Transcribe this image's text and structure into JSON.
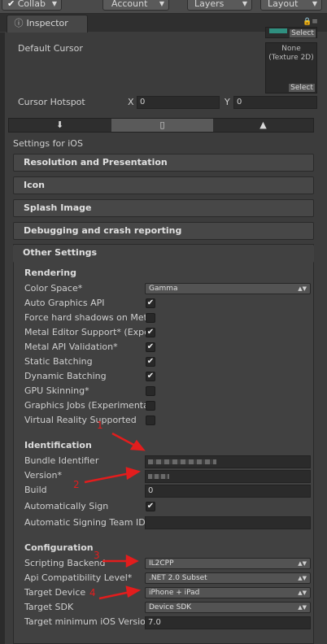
{
  "toolbar": {
    "collab": "Collab",
    "account": "Account",
    "layers": "Layers",
    "layout": "Layout"
  },
  "tab": {
    "label": "Inspector"
  },
  "cursor": {
    "default_cursor_label": "Default Cursor",
    "texture_none": "None",
    "texture_type": "(Texture 2D)",
    "select_label": "Select",
    "hotspot_label": "Cursor Hotspot",
    "x_label": "X",
    "x_value": "0",
    "y_label": "Y",
    "y_value": "0"
  },
  "platforms": {
    "icons": [
      "download-icon",
      "iphone-icon",
      "android-icon"
    ],
    "selected": 1
  },
  "settings_for": "Settings for iOS",
  "sections": {
    "resolution": "Resolution and Presentation",
    "icon": "Icon",
    "splash": "Splash Image",
    "debugging": "Debugging and crash reporting",
    "other": "Other Settings"
  },
  "rendering": {
    "header": "Rendering",
    "color_space_label": "Color Space*",
    "color_space_value": "Gamma",
    "auto_graphics": "Auto Graphics API",
    "force_shadows": "Force hard shadows on Met",
    "metal_editor": "Metal Editor Support* (Expe",
    "metal_api": "Metal API Validation*",
    "static_batching": "Static Batching",
    "dynamic_batching": "Dynamic Batching",
    "gpu_skinning": "GPU Skinning*",
    "graphics_jobs": "Graphics Jobs (Experimenta",
    "vr_supported": "Virtual Reality Supported"
  },
  "identification": {
    "header": "Identification",
    "bundle_label": "Bundle Identifier",
    "version_label": "Version*",
    "build_label": "Build",
    "build_value": "0",
    "auto_sign_label": "Automatically Sign",
    "team_id_label": "Automatic Signing Team ID"
  },
  "configuration": {
    "header": "Configuration",
    "backend_label": "Scripting Backend",
    "backend_value": "IL2CPP",
    "api_label": "Api Compatibility Level*",
    "api_value": ".NET 2.0 Subset",
    "device_label": "Target Device",
    "device_value": "iPhone + iPad",
    "sdk_label": "Target SDK",
    "sdk_value": "Device SDK",
    "min_ios_label": "Target minimum iOS Versio",
    "min_ios_value": "7.0"
  },
  "annotations": [
    "1",
    "2",
    "3",
    "4"
  ],
  "colors": {
    "annotation": "#e21d1d",
    "background": "#3c3c3c"
  }
}
